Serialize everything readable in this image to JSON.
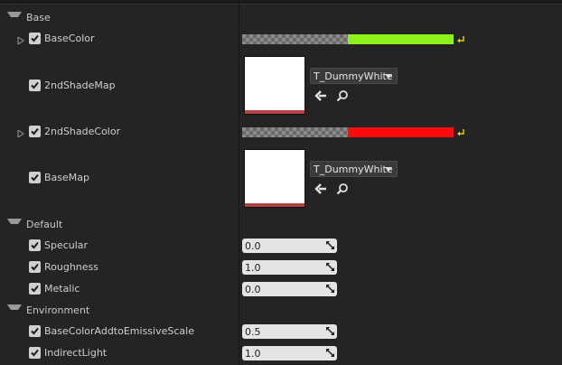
{
  "sections": {
    "base": "Base",
    "default": "Default",
    "environment": "Environment"
  },
  "base_rows": {
    "base_color": {
      "label": "BaseColor",
      "color": "#8ef21a"
    },
    "second_shade_map": {
      "label": "2ndShadeMap",
      "asset": "T_DummyWhite"
    },
    "second_shade_color": {
      "label": "2ndShadeColor",
      "color": "#ff0a0a"
    },
    "base_map": {
      "label": "BaseMap",
      "asset": "T_DummyWhite"
    }
  },
  "default_rows": {
    "specular": {
      "label": "Specular",
      "value": "0.0"
    },
    "roughness": {
      "label": "Roughness",
      "value": "1.0"
    },
    "metalic": {
      "label": "Metalic",
      "value": "0.0"
    }
  },
  "environment_rows": {
    "emissive_scale": {
      "label": "BaseColorAddtoEmissiveScale",
      "value": "0.5"
    },
    "indirect_light": {
      "label": "IndirectLight",
      "value": "1.0"
    }
  },
  "icons": {
    "expand_down": "triangle-down-icon",
    "expand_right": "triangle-right-icon",
    "checkbox": "checkmark-icon",
    "reset": "reset-arrow-icon",
    "use_selected": "left-arrow-icon",
    "browse": "magnifier-icon",
    "grip": "resize-grip-icon"
  }
}
